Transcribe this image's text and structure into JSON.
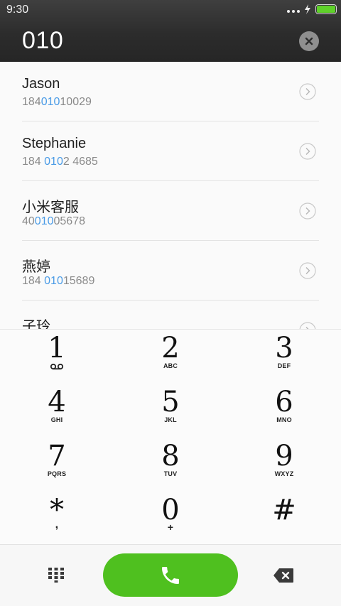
{
  "status_bar": {
    "time": "9:30",
    "battery_color": "#5fd12a"
  },
  "dial_input": {
    "value": "010",
    "clear_icon": "close-icon"
  },
  "contacts": [
    {
      "name": "Jason",
      "number_pre": "184",
      "number_match": "010",
      "number_post": "10029"
    },
    {
      "name": "Stephanie",
      "number_pre": "184 ",
      "number_match": "010",
      "number_post": "2 4685"
    },
    {
      "name": "小米客服",
      "number_pre": "40",
      "number_match": "010",
      "number_post": "05678"
    },
    {
      "name": "燕婷",
      "number_pre": "184 ",
      "number_match": "010",
      "number_post": "15689"
    },
    {
      "name": "子玲",
      "number_pre": "",
      "number_match": "",
      "number_post": ""
    }
  ],
  "keypad": {
    "keys": [
      {
        "digit": "1",
        "letters": "",
        "icon": "voicemail-icon"
      },
      {
        "digit": "2",
        "letters": "ABC"
      },
      {
        "digit": "3",
        "letters": "DEF"
      },
      {
        "digit": "4",
        "letters": "GHI"
      },
      {
        "digit": "5",
        "letters": "JKL"
      },
      {
        "digit": "6",
        "letters": "MNO"
      },
      {
        "digit": "7",
        "letters": "PQRS"
      },
      {
        "digit": "8",
        "letters": "TUV"
      },
      {
        "digit": "9",
        "letters": "WXYZ"
      },
      {
        "digit": "*",
        "letters": ","
      },
      {
        "digit": "0",
        "letters": "+"
      },
      {
        "digit": "#",
        "letters": ""
      }
    ]
  },
  "bottom_bar": {
    "dialpad_icon": "dialpad-icon",
    "call_icon": "phone-icon",
    "backspace_icon": "backspace-icon",
    "call_color": "#4fc01f"
  },
  "colors": {
    "highlight": "#4a9be6"
  }
}
